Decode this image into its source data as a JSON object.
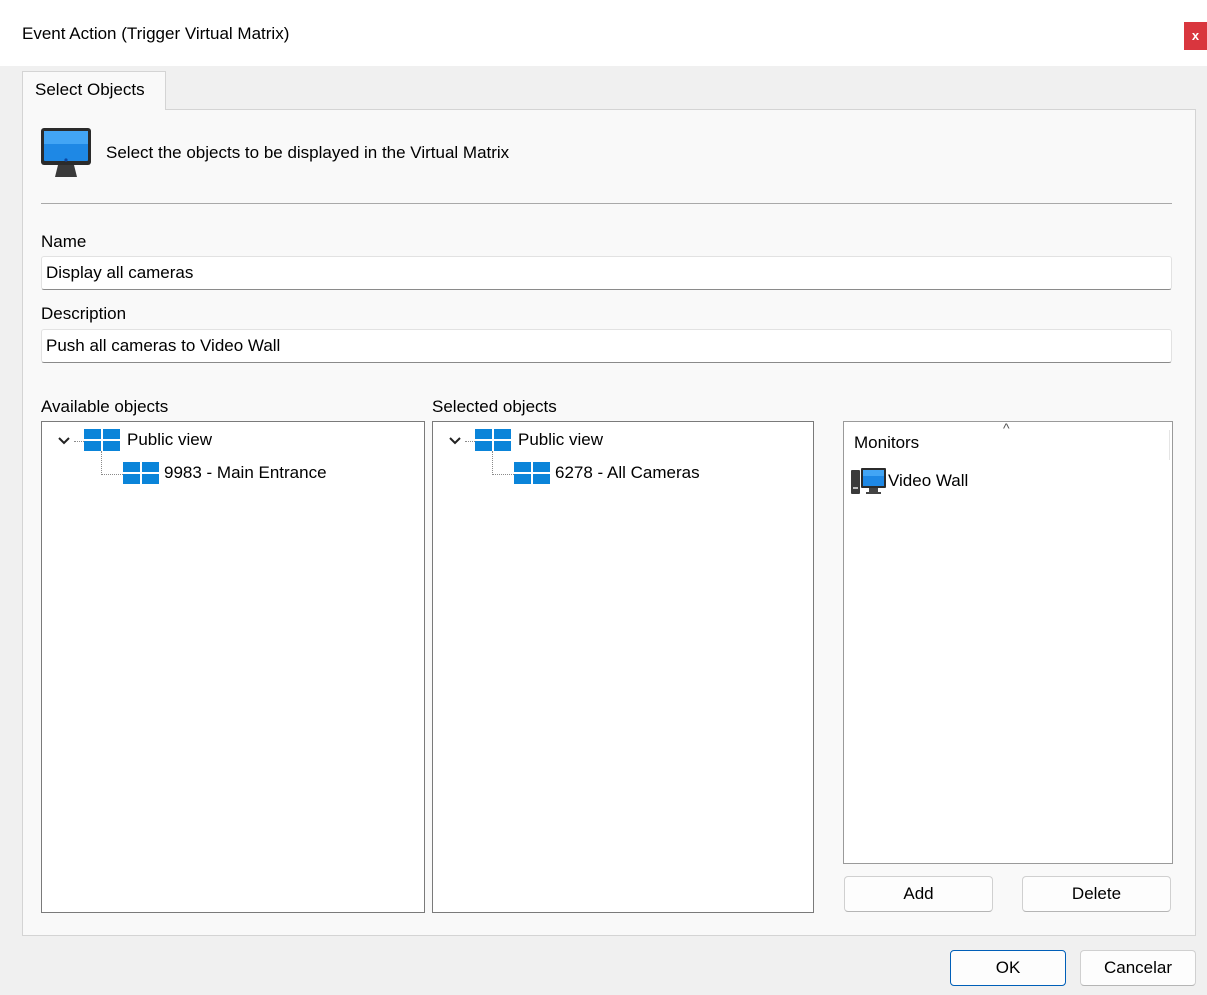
{
  "window": {
    "title": "Event Action (Trigger Virtual Matrix)",
    "close_label": "x"
  },
  "tabs": [
    {
      "label": "Select Objects"
    }
  ],
  "header": {
    "icon": "monitor-icon",
    "text": "Select the objects to be displayed in the Virtual Matrix"
  },
  "form": {
    "name_label": "Name",
    "name_value": "Display all cameras",
    "description_label": "Description",
    "description_value": "Push all cameras to Video Wall"
  },
  "available": {
    "label": "Available objects",
    "root": {
      "label": "Public view",
      "icon": "grid-view-icon",
      "expanded": true
    },
    "children": [
      {
        "label": "9983 - Main Entrance",
        "icon": "grid-view-icon"
      }
    ]
  },
  "selected": {
    "label": "Selected objects",
    "root": {
      "label": "Public view",
      "icon": "grid-view-icon",
      "expanded": true
    },
    "children": [
      {
        "label": "6278 - All Cameras",
        "icon": "grid-view-icon"
      }
    ]
  },
  "monitors": {
    "column_header": "Monitors",
    "sort_indicator": "^",
    "items": [
      {
        "label": "Video Wall",
        "icon": "computer-monitor-icon"
      }
    ],
    "add_label": "Add",
    "delete_label": "Delete"
  },
  "footer": {
    "ok_label": "OK",
    "cancel_label": "Cancelar"
  },
  "colors": {
    "accent": "#0078d4",
    "close": "#d9363e"
  }
}
